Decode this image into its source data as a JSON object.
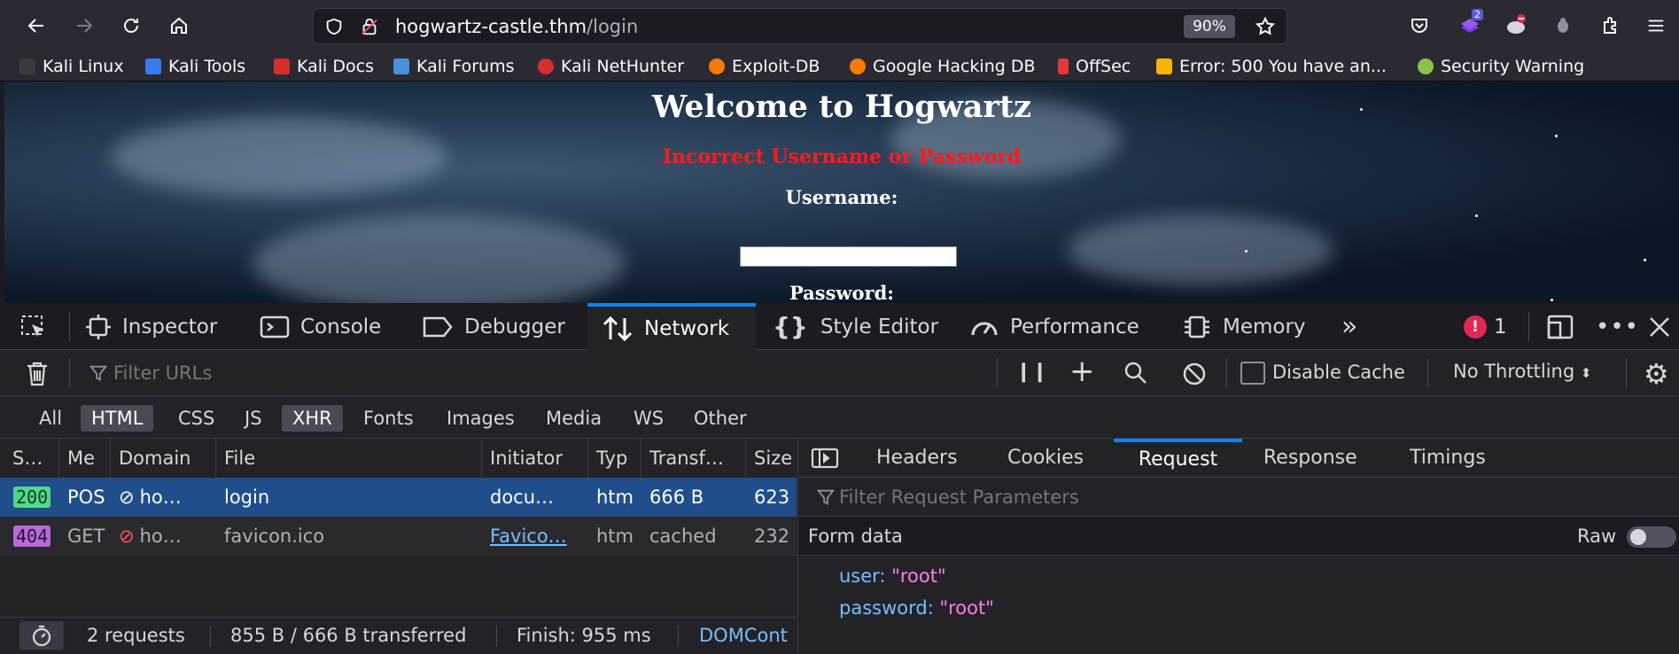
{
  "browser": {
    "url_host": "hogwartz-castle.thm",
    "url_path": "/login",
    "zoom": "90%",
    "notification_count": "2"
  },
  "bookmarks": [
    {
      "label": "Kali Linux",
      "color": "#cfcfcf"
    },
    {
      "label": "Kali Tools",
      "color": "#367bf0"
    },
    {
      "label": "Kali Docs",
      "color": "#d32f2f"
    },
    {
      "label": "Kali Forums",
      "color": "#4a90d9"
    },
    {
      "label": "Kali NetHunter",
      "color": "#d32f2f"
    },
    {
      "label": "Exploit-DB",
      "color": "#f57c00"
    },
    {
      "label": "Google Hacking DB",
      "color": "#f57c00"
    },
    {
      "label": "OffSec",
      "color": "#e53935"
    },
    {
      "label": "Error: 500 You have an...",
      "color": "#f4b400"
    },
    {
      "label": "Security Warning",
      "color": "#8bc34a"
    }
  ],
  "page": {
    "title": "Welcome to Hogwartz",
    "error": "Incorrect Username or Password",
    "username_label": "Username:",
    "password_label": "Password:"
  },
  "devtools": {
    "tabs": [
      "Inspector",
      "Console",
      "Debugger",
      "Network",
      "Style Editor",
      "Performance",
      "Memory"
    ],
    "error_count": "1",
    "filter_placeholder": "Filter URLs",
    "disable_cache": "Disable Cache",
    "throttling": "No Throttling",
    "type_filters": [
      "All",
      "HTML",
      "CSS",
      "JS",
      "XHR",
      "Fonts",
      "Images",
      "Media",
      "WS",
      "Other"
    ],
    "columns": [
      "S…",
      "Me",
      "Domain",
      "File",
      "Initiator",
      "Typ",
      "Transf…",
      "Size"
    ],
    "requests": [
      {
        "status": "200",
        "method": "POS",
        "domain": "ho…",
        "file": "login",
        "initiator": "docu…",
        "type": "htm",
        "transferred": "666 B",
        "size": "623"
      },
      {
        "status": "404",
        "method": "GET",
        "domain": "ho…",
        "file": "favicon.ico",
        "initiator": "Favico…",
        "type": "htm",
        "transferred": "cached",
        "size": "232"
      }
    ],
    "status_bar": {
      "requests": "2 requests",
      "transferred": "855 B / 666 B transferred",
      "finish": "Finish: 955 ms",
      "domcontent": "DOMCont"
    },
    "side_tabs": [
      "Headers",
      "Cookies",
      "Request",
      "Response",
      "Timings"
    ],
    "param_filter": "Filter Request Parameters",
    "form_data_label": "Form data",
    "raw_label": "Raw",
    "form_fields": [
      {
        "key": "user:",
        "value": "\"root\""
      },
      {
        "key": "password:",
        "value": "\"root\""
      }
    ]
  },
  "colors": {
    "accent": "#0a84ff",
    "error_red": "#ff1a1a",
    "selected_row": "#204e8a"
  }
}
